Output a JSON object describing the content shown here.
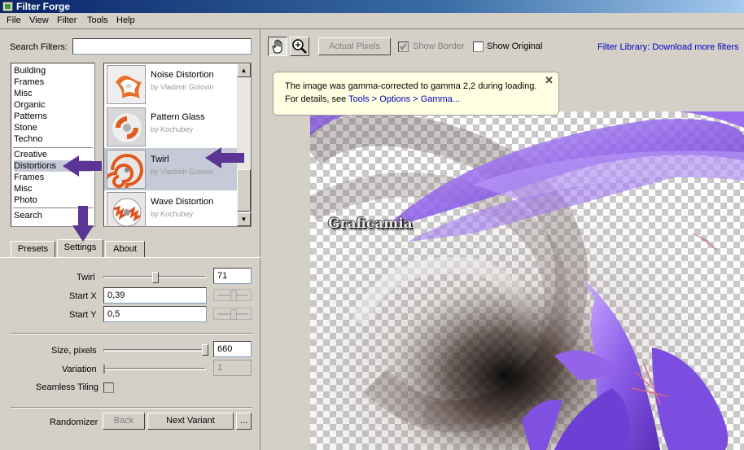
{
  "window": {
    "title": "Filter Forge"
  },
  "menu": [
    "File",
    "View",
    "Filter",
    "Tools",
    "Help"
  ],
  "search": {
    "label": "Search Filters:",
    "value": ""
  },
  "categories": {
    "group1": [
      "Building",
      "Frames",
      "Misc",
      "Organic",
      "Patterns",
      "Stone",
      "Techno"
    ],
    "group2": [
      "Creative",
      "Distortions",
      "Frames",
      "Misc",
      "Photo"
    ],
    "group3": [
      "Search"
    ],
    "selected": "Distortions"
  },
  "filters": [
    {
      "name": "Noise Distortion",
      "author": "by Vladimir Golovin"
    },
    {
      "name": "Pattern Glass",
      "author": "by Kochubey"
    },
    {
      "name": "Twirl",
      "author": "by Vladimir Golovin"
    },
    {
      "name": "Wave Distortion",
      "author": "by Kochubey"
    }
  ],
  "tabs": [
    "Presets",
    "Settings",
    "About"
  ],
  "active_tab": "Settings",
  "settings": {
    "twirl": {
      "label": "Twirl",
      "value": "71",
      "level": 0.71
    },
    "start_x": {
      "label": "Start X",
      "value": "0,39"
    },
    "start_y": {
      "label": "Start Y",
      "value": "0,5"
    },
    "size": {
      "label": "Size, pixels",
      "value": "660",
      "level": 1.0
    },
    "variation": {
      "label": "Variation",
      "value": "1"
    },
    "seamless": {
      "label": "Seamless Tiling",
      "checked": false
    }
  },
  "randomizer": {
    "label": "Randomizer",
    "back": "Back",
    "next": "Next Variant",
    "more": "..."
  },
  "toolbar": {
    "actual_pixels": "Actual Pixels",
    "show_border": "Show Border",
    "show_original": "Show Original",
    "library_link": "Filter Library: Download more filters"
  },
  "notice": {
    "line1": "The image was gamma-corrected to gamma 2,2 during loading.",
    "line2_prefix": "For details, see ",
    "line2_link": "Tools > Options > Gamma...",
    "close": "✕"
  },
  "preview": {
    "watermark": "Graficamia"
  },
  "colors": {
    "accent_arrow": "#5b3596",
    "selection": "#c6cad8",
    "link": "#0000c0",
    "notice_bg": "#ffffe1"
  }
}
